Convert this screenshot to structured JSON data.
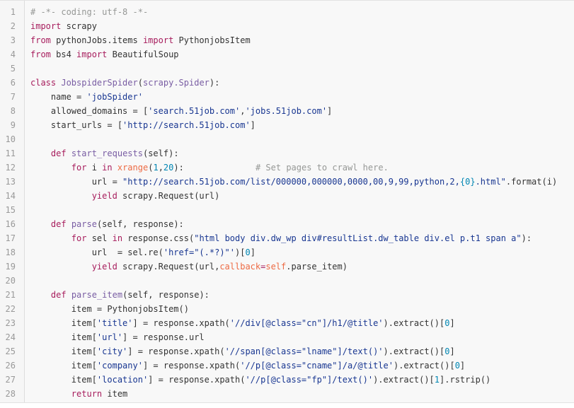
{
  "editor": {
    "language": "python",
    "colors": {
      "background": "#f8f8f8",
      "gutter": "#f6f6f6",
      "line_number": "#999999",
      "keyword": "#a71d5d",
      "string": "#183691",
      "number": "#0086b3",
      "comment": "#969896",
      "function": "#795da3",
      "argument": "#ed6a43",
      "text": "#333333"
    },
    "lines": [
      {
        "n": "1",
        "tokens": [
          {
            "t": "# -*- coding: utf-8 -*-",
            "c": "cm"
          }
        ]
      },
      {
        "n": "2",
        "tokens": [
          {
            "t": "import",
            "c": "kw"
          },
          {
            "t": " scrapy",
            "c": "plain"
          }
        ]
      },
      {
        "n": "3",
        "tokens": [
          {
            "t": "from",
            "c": "kw"
          },
          {
            "t": " pythonJobs.items ",
            "c": "plain"
          },
          {
            "t": "import",
            "c": "kw"
          },
          {
            "t": " PythonjobsItem",
            "c": "plain"
          }
        ]
      },
      {
        "n": "4",
        "tokens": [
          {
            "t": "from",
            "c": "kw"
          },
          {
            "t": " bs4 ",
            "c": "plain"
          },
          {
            "t": "import",
            "c": "kw"
          },
          {
            "t": " BeautifulSoup",
            "c": "plain"
          }
        ]
      },
      {
        "n": "5",
        "tokens": []
      },
      {
        "n": "6",
        "tokens": [
          {
            "t": "class",
            "c": "kw"
          },
          {
            "t": " ",
            "c": "plain"
          },
          {
            "t": "JobspiderSpider",
            "c": "fn"
          },
          {
            "t": "(",
            "c": "plain"
          },
          {
            "t": "scrapy.Spider",
            "c": "fn"
          },
          {
            "t": "):",
            "c": "plain"
          }
        ]
      },
      {
        "n": "7",
        "tokens": [
          {
            "t": "    name = ",
            "c": "plain"
          },
          {
            "t": "'jobSpider'",
            "c": "str"
          }
        ]
      },
      {
        "n": "8",
        "tokens": [
          {
            "t": "    allowed_domains = [",
            "c": "plain"
          },
          {
            "t": "'search.51job.com'",
            "c": "str"
          },
          {
            "t": ",",
            "c": "plain"
          },
          {
            "t": "'jobs.51job.com'",
            "c": "str"
          },
          {
            "t": "]",
            "c": "plain"
          }
        ]
      },
      {
        "n": "9",
        "tokens": [
          {
            "t": "    start_urls = [",
            "c": "plain"
          },
          {
            "t": "'http://search.51job.com'",
            "c": "str"
          },
          {
            "t": "]",
            "c": "plain"
          }
        ]
      },
      {
        "n": "10",
        "tokens": []
      },
      {
        "n": "11",
        "tokens": [
          {
            "t": "    ",
            "c": "plain"
          },
          {
            "t": "def",
            "c": "kw"
          },
          {
            "t": " ",
            "c": "plain"
          },
          {
            "t": "start_requests",
            "c": "fn"
          },
          {
            "t": "(self):",
            "c": "plain"
          }
        ]
      },
      {
        "n": "12",
        "tokens": [
          {
            "t": "        ",
            "c": "plain"
          },
          {
            "t": "for",
            "c": "kw"
          },
          {
            "t": " i ",
            "c": "plain"
          },
          {
            "t": "in",
            "c": "kw"
          },
          {
            "t": " ",
            "c": "plain"
          },
          {
            "t": "xrange",
            "c": "arg"
          },
          {
            "t": "(",
            "c": "plain"
          },
          {
            "t": "1",
            "c": "num"
          },
          {
            "t": ",",
            "c": "plain"
          },
          {
            "t": "20",
            "c": "num"
          },
          {
            "t": "):              ",
            "c": "plain"
          },
          {
            "t": "# Set pages to crawl here.",
            "c": "cm"
          }
        ]
      },
      {
        "n": "13",
        "tokens": [
          {
            "t": "            url = ",
            "c": "plain"
          },
          {
            "t": "\"http://search.51job.com/list/000000,000000,0000,00,9,99,python,2,",
            "c": "str"
          },
          {
            "t": "{0}",
            "c": "num"
          },
          {
            "t": ".html\"",
            "c": "str"
          },
          {
            "t": ".format(i)",
            "c": "plain"
          }
        ]
      },
      {
        "n": "14",
        "tokens": [
          {
            "t": "            ",
            "c": "plain"
          },
          {
            "t": "yield",
            "c": "kw"
          },
          {
            "t": " scrapy.Request(url)",
            "c": "plain"
          }
        ]
      },
      {
        "n": "15",
        "tokens": []
      },
      {
        "n": "16",
        "tokens": [
          {
            "t": "    ",
            "c": "plain"
          },
          {
            "t": "def",
            "c": "kw"
          },
          {
            "t": " ",
            "c": "plain"
          },
          {
            "t": "parse",
            "c": "fn"
          },
          {
            "t": "(self, response):",
            "c": "plain"
          }
        ]
      },
      {
        "n": "17",
        "tokens": [
          {
            "t": "        ",
            "c": "plain"
          },
          {
            "t": "for",
            "c": "kw"
          },
          {
            "t": " sel ",
            "c": "plain"
          },
          {
            "t": "in",
            "c": "kw"
          },
          {
            "t": " response.css(",
            "c": "plain"
          },
          {
            "t": "\"html body div.dw_wp div#resultList.dw_table div.el p.t1 span a\"",
            "c": "str"
          },
          {
            "t": "):",
            "c": "plain"
          }
        ]
      },
      {
        "n": "18",
        "tokens": [
          {
            "t": "            url  = sel.re(",
            "c": "plain"
          },
          {
            "t": "'href=\"(.*?)\"'",
            "c": "str"
          },
          {
            "t": ")[",
            "c": "plain"
          },
          {
            "t": "0",
            "c": "num"
          },
          {
            "t": "]",
            "c": "plain"
          }
        ]
      },
      {
        "n": "19",
        "tokens": [
          {
            "t": "            ",
            "c": "plain"
          },
          {
            "t": "yield",
            "c": "kw"
          },
          {
            "t": " scrapy.Request(url,",
            "c": "plain"
          },
          {
            "t": "callback",
            "c": "arg"
          },
          {
            "t": "=",
            "c": "kw"
          },
          {
            "t": "self",
            "c": "arg"
          },
          {
            "t": ".parse_item)",
            "c": "plain"
          }
        ]
      },
      {
        "n": "20",
        "tokens": []
      },
      {
        "n": "21",
        "tokens": [
          {
            "t": "    ",
            "c": "plain"
          },
          {
            "t": "def",
            "c": "kw"
          },
          {
            "t": " ",
            "c": "plain"
          },
          {
            "t": "parse_item",
            "c": "fn"
          },
          {
            "t": "(self, response):",
            "c": "plain"
          }
        ]
      },
      {
        "n": "22",
        "tokens": [
          {
            "t": "        item = PythonjobsItem()",
            "c": "plain"
          }
        ]
      },
      {
        "n": "23",
        "tokens": [
          {
            "t": "        item[",
            "c": "plain"
          },
          {
            "t": "'title'",
            "c": "str"
          },
          {
            "t": "] = response.xpath(",
            "c": "plain"
          },
          {
            "t": "'//div[@class=\"cn\"]/h1/@title'",
            "c": "str"
          },
          {
            "t": ").extract()[",
            "c": "plain"
          },
          {
            "t": "0",
            "c": "num"
          },
          {
            "t": "]",
            "c": "plain"
          }
        ]
      },
      {
        "n": "24",
        "tokens": [
          {
            "t": "        item[",
            "c": "plain"
          },
          {
            "t": "'url'",
            "c": "str"
          },
          {
            "t": "] = response.url",
            "c": "plain"
          }
        ]
      },
      {
        "n": "25",
        "tokens": [
          {
            "t": "        item[",
            "c": "plain"
          },
          {
            "t": "'city'",
            "c": "str"
          },
          {
            "t": "] = response.xpath(",
            "c": "plain"
          },
          {
            "t": "'//span[@class=\"lname\"]/text()'",
            "c": "str"
          },
          {
            "t": ").extract()[",
            "c": "plain"
          },
          {
            "t": "0",
            "c": "num"
          },
          {
            "t": "]",
            "c": "plain"
          }
        ]
      },
      {
        "n": "26",
        "tokens": [
          {
            "t": "        item[",
            "c": "plain"
          },
          {
            "t": "'company'",
            "c": "str"
          },
          {
            "t": "] = response.xpath(",
            "c": "plain"
          },
          {
            "t": "'//p[@class=\"cname\"]/a/@title'",
            "c": "str"
          },
          {
            "t": ").extract()[",
            "c": "plain"
          },
          {
            "t": "0",
            "c": "num"
          },
          {
            "t": "]",
            "c": "plain"
          }
        ]
      },
      {
        "n": "27",
        "tokens": [
          {
            "t": "        item[",
            "c": "plain"
          },
          {
            "t": "'location'",
            "c": "str"
          },
          {
            "t": "] = response.xpath(",
            "c": "plain"
          },
          {
            "t": "'//p[@class=\"fp\"]/text()'",
            "c": "str"
          },
          {
            "t": ").extract()[",
            "c": "plain"
          },
          {
            "t": "1",
            "c": "num"
          },
          {
            "t": "].rstrip()",
            "c": "plain"
          }
        ]
      },
      {
        "n": "28",
        "tokens": [
          {
            "t": "        ",
            "c": "plain"
          },
          {
            "t": "return",
            "c": "kw"
          },
          {
            "t": " item",
            "c": "plain"
          }
        ]
      }
    ]
  }
}
